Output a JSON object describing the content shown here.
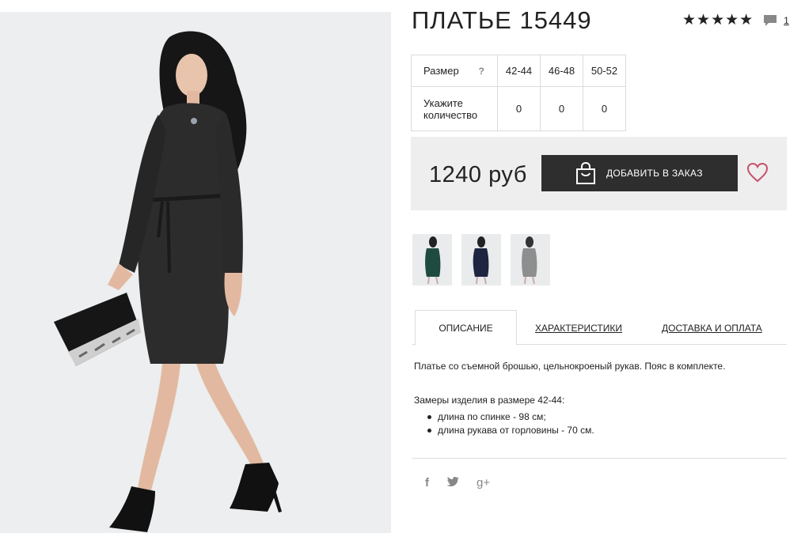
{
  "product": {
    "title": "ПЛАТЬЕ 15449",
    "rating_stars": "★★★★★",
    "review_count": "1"
  },
  "size_table": {
    "size_label": "Размер",
    "help_mark": "?",
    "sizes": [
      "42-44",
      "46-48",
      "50-52"
    ],
    "qty_label_line1": "Укажите",
    "qty_label_line2": "количество",
    "quantities": [
      "0",
      "0",
      "0"
    ]
  },
  "buy": {
    "price": "1240 руб",
    "add_button": "ДОБАВИТЬ В ЗАКАЗ"
  },
  "thumbnails": [
    {
      "color": "#1f4a40"
    },
    {
      "color": "#1e2540"
    },
    {
      "color": "#8e8e8e"
    }
  ],
  "tabs": {
    "description": "ОПИСАНИЕ",
    "characteristics": "ХАРАКТЕРИСТИКИ",
    "delivery": "ДОСТАВКА И ОПЛАТА"
  },
  "description": {
    "text": "Платье со съемной брошью, цельнокроеный рукав. Пояс в комплекте.",
    "measure_title": "Замеры изделия в размере 42-44:",
    "measures": [
      "длина по спинке - 98 см;",
      "длина рукава от горловины - 70 см."
    ]
  },
  "social": {
    "facebook": "f",
    "twitter": "t",
    "gplus": "g+"
  },
  "colors": {
    "dress": "#2c2c2c",
    "button": "#2e2e2e",
    "heart": "#c8506a",
    "panel": "#eeeeee"
  }
}
